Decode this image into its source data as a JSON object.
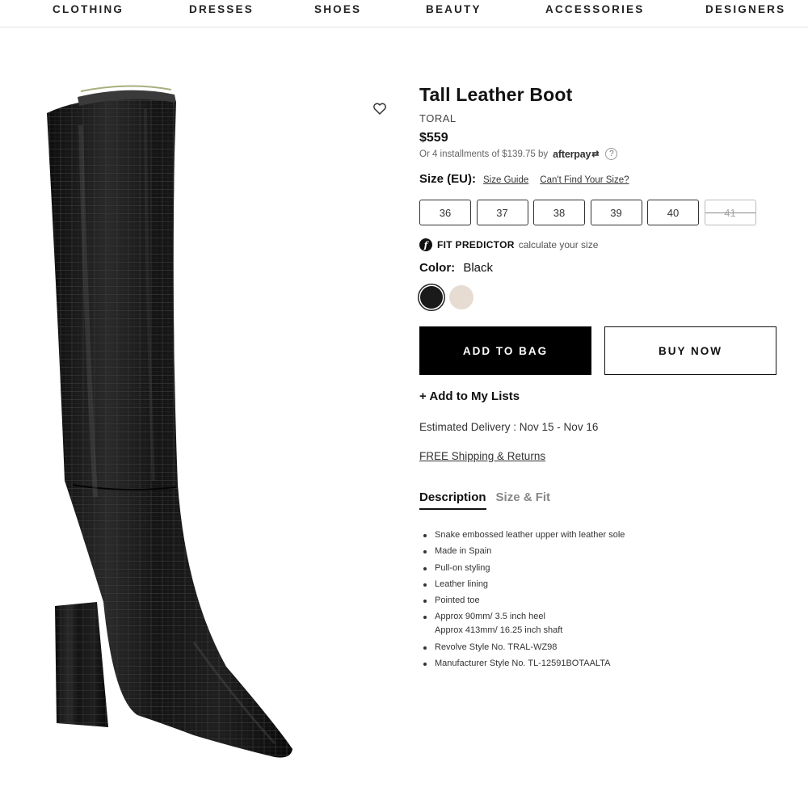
{
  "nav": {
    "items": [
      "CLOTHING",
      "DRESSES",
      "SHOES",
      "BEAUTY",
      "ACCESSORIES",
      "DESIGNERS"
    ]
  },
  "product": {
    "title": "Tall Leather Boot",
    "brand": "TORAL",
    "price": "$559",
    "installments_text": "Or 4 installments of $139.75 by",
    "afterpay_label": "afterpay",
    "afterpay_help": "?",
    "wishlist_icon": "heart-outline-icon"
  },
  "size": {
    "label": "Size (EU):",
    "guide_link": "Size Guide",
    "cant_find_link": "Can't Find Your Size?",
    "options": [
      {
        "label": "36",
        "available": true
      },
      {
        "label": "37",
        "available": true
      },
      {
        "label": "38",
        "available": true
      },
      {
        "label": "39",
        "available": true
      },
      {
        "label": "40",
        "available": true
      },
      {
        "label": "41",
        "available": false
      }
    ]
  },
  "fit_predictor": {
    "icon_letter": "f",
    "title": "FIT PREDICTOR",
    "subtitle": "calculate your size"
  },
  "color": {
    "label": "Color:",
    "value": "Black",
    "swatches": [
      {
        "name": "Black",
        "hex": "#1a1a1a",
        "selected": true
      },
      {
        "name": "Bone",
        "hex": "#e6dcd2",
        "selected": false
      }
    ]
  },
  "actions": {
    "add_to_bag": "ADD TO BAG",
    "buy_now": "BUY NOW",
    "add_to_lists": "+ Add to My Lists"
  },
  "delivery": {
    "estimated": "Estimated Delivery : Nov 15 - Nov 16",
    "shipping_link": "FREE Shipping & Returns"
  },
  "tabs": [
    {
      "label": "Description",
      "active": true
    },
    {
      "label": "Size & Fit",
      "active": false
    }
  ],
  "details": [
    [
      "Snake embossed leather upper with leather sole"
    ],
    [
      "Made in Spain"
    ],
    [
      "Pull-on styling"
    ],
    [
      "Leather lining"
    ],
    [
      "Pointed toe"
    ],
    [
      "Approx 90mm/ 3.5 inch heel",
      "Approx 413mm/ 16.25 inch shaft"
    ],
    [
      "Revolve Style No. TRAL-WZ98"
    ],
    [
      "Manufacturer Style No. TL-12591BOTAALTA"
    ]
  ]
}
